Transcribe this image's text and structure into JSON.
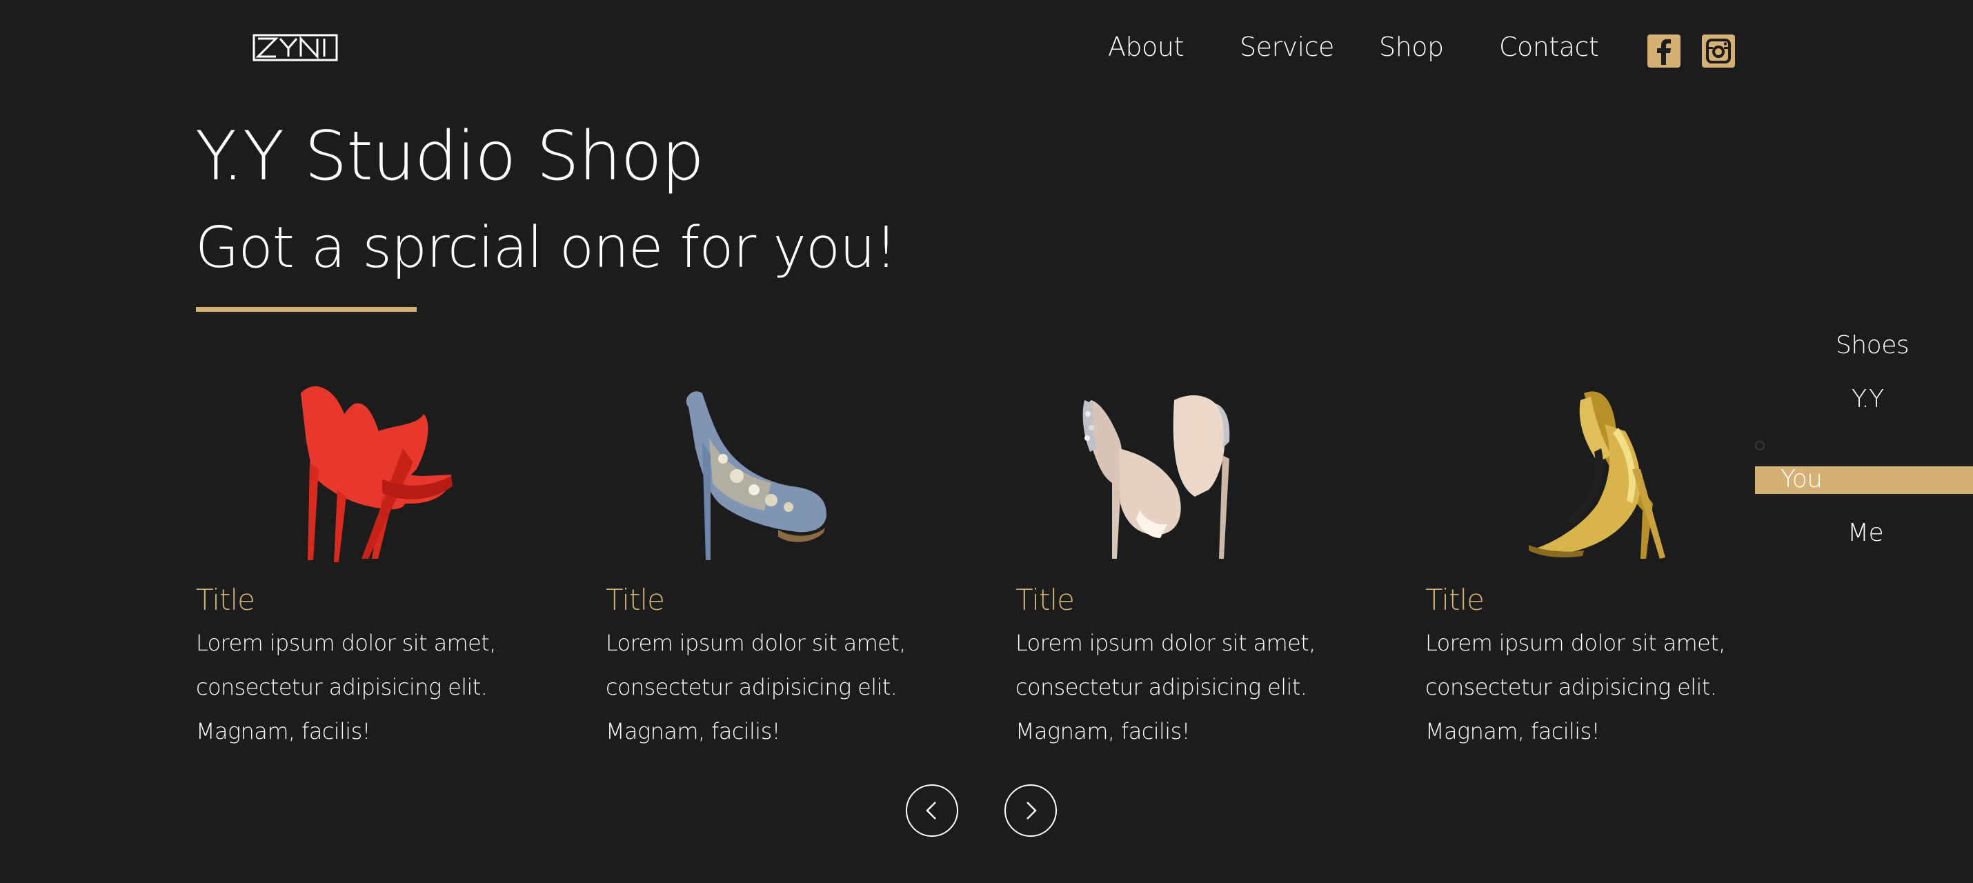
{
  "brand": {
    "logo_text": "ZYNI"
  },
  "nav": {
    "items": [
      "About",
      "Service",
      "Shop",
      "Contact"
    ]
  },
  "social": {
    "facebook": "facebook-icon",
    "instagram": "instagram-icon"
  },
  "hero": {
    "title": "Y.Y Studio Shop",
    "subtitle": "Got a sprcial one for you!"
  },
  "products": [
    {
      "title": "Title",
      "description": "Lorem ipsum dolor sit amet, consectetur adipisicing elit. Magnam, facilis!",
      "image": "red-patent-high-heel-pumps"
    },
    {
      "title": "Title",
      "description": "Lorem ipsum dolor sit amet, consectetur adipisicing elit. Magnam, facilis!",
      "image": "denim-jeweled-peep-toe-heel"
    },
    {
      "title": "Title",
      "description": "Lorem ipsum dolor sit amet, consectetur adipisicing elit. Magnam, facilis!",
      "image": "nude-satin-crystal-heels"
    },
    {
      "title": "Title",
      "description": "Lorem ipsum dolor sit amet, consectetur adipisicing elit. Magnam, facilis!",
      "image": "gold-metallic-pointed-heels"
    }
  ],
  "carousel": {
    "prev": "chevron-left-icon",
    "next": "chevron-right-icon"
  },
  "side_nav": {
    "items": [
      "Shoes",
      "Y.Y",
      "You",
      "Me"
    ],
    "active": "You"
  },
  "colors": {
    "background": "#1c1c1c",
    "accent": "#d4b074",
    "text": "#ffffff"
  }
}
